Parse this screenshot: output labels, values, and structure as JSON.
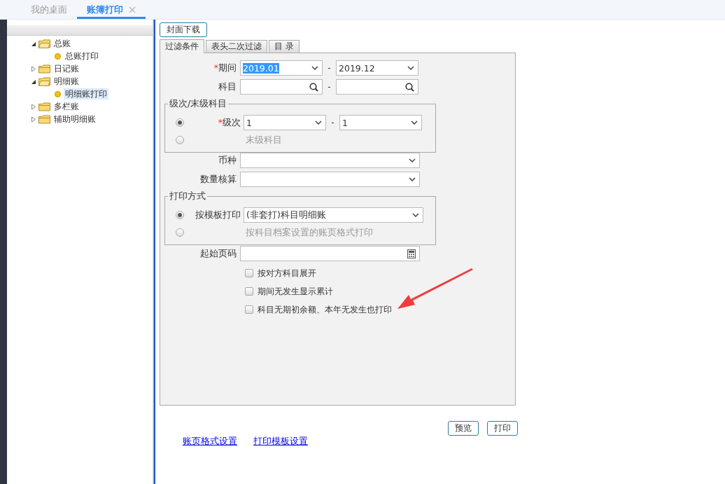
{
  "tabs": [
    {
      "label": "我的桌面",
      "selected": false,
      "closable": false
    },
    {
      "label": "账簿打印",
      "selected": true,
      "closable": true
    }
  ],
  "tree": [
    {
      "label": "总账",
      "expanded": true,
      "children": [
        {
          "label": "总账打印",
          "selected": false
        }
      ]
    },
    {
      "label": "日记账",
      "expanded": false
    },
    {
      "label": "明细账",
      "expanded": true,
      "children": [
        {
          "label": "明细账打印",
          "selected": true
        }
      ]
    },
    {
      "label": "多栏账",
      "expanded": false
    },
    {
      "label": "辅助明细账",
      "expanded": false
    }
  ],
  "cover_button": "封面下载",
  "form_tabs": [
    {
      "label": "过滤条件",
      "selected": true
    },
    {
      "label": "表头二次过滤",
      "selected": false
    },
    {
      "label": "目 录",
      "selected": false
    }
  ],
  "period": {
    "mark": "*",
    "label": "期间",
    "separator": "-",
    "from": {
      "value": "2019.01",
      "highlighted": true
    },
    "to": {
      "value": "2019.12",
      "highlighted": false
    }
  },
  "subject": {
    "label": "科目",
    "separator": "-"
  },
  "level_group": {
    "legend": "级次/末级科目",
    "options": [
      {
        "kind": "range",
        "selected": true,
        "mark": "*",
        "label": "级次",
        "from": "1",
        "to": "1",
        "separator": "-"
      },
      {
        "kind": "text",
        "selected": false,
        "label": "末级科目"
      }
    ]
  },
  "currency": {
    "label": "币种"
  },
  "quantity": {
    "label": "数量核算"
  },
  "print_group": {
    "legend": "打印方式",
    "options": [
      {
        "kind": "select",
        "selected": true,
        "label": "按模板打印",
        "value": "(非套打)科目明细账"
      },
      {
        "kind": "text",
        "selected": false,
        "label": "按科目档案设置的账页格式打印"
      }
    ]
  },
  "start_page": {
    "label": "起始页码"
  },
  "checkboxes": [
    {
      "label": "按对方科目展开",
      "checked": false
    },
    {
      "label": "期间无发生显示累计",
      "checked": false
    },
    {
      "label": "科目无期初余额、本年无发生也打印",
      "checked": false
    }
  ],
  "links": [
    "账页格式设置",
    "打印模板设置"
  ],
  "buttons": [
    "预览",
    "打印"
  ]
}
